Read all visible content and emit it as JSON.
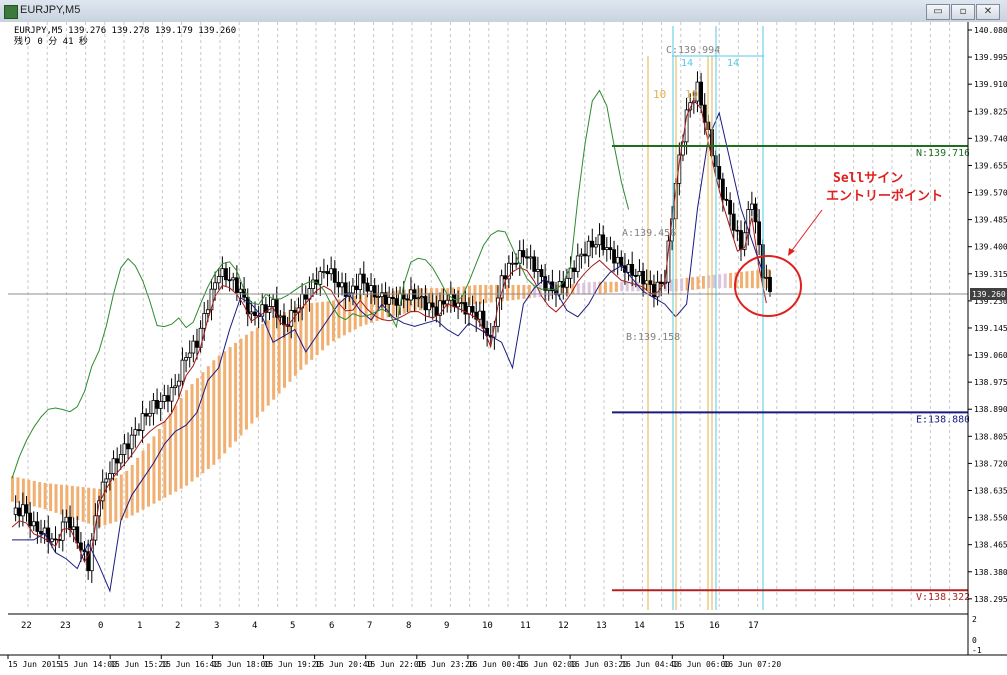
{
  "window": {
    "title": "EURJPY,M5",
    "minimize": "▭",
    "maximize": "▫",
    "close": "✕"
  },
  "chart_info": {
    "symbol_line": "EURJPY,M5  139.276 139.278 139.179 139.260",
    "countdown": "残り 0 分 41 秒"
  },
  "annotation": {
    "line1": "Sellサイン",
    "line2": "エントリーポイント"
  },
  "colors": {
    "cloud": "#f0a762",
    "cloud_lower": "#d8bfd8",
    "tenkan": "#a31a1a",
    "kijun": "#1a1a80",
    "chikou": "#2e8b2e",
    "n_level": "#1f6e1f",
    "e_level": "#1a1a80",
    "v_level": "#b22222",
    "annotation": "#e02020",
    "fib_orange": "#e8b04a",
    "fib_cyan": "#52c8e6"
  },
  "chart_data": {
    "type": "candlestick",
    "ylim": [
      138.26,
      140.08
    ],
    "yticks": [
      "140.080",
      "139.995",
      "139.910",
      "139.825",
      "139.740",
      "139.655",
      "139.570",
      "139.485",
      "139.400",
      "139.315",
      "139.230",
      "139.145",
      "139.060",
      "138.975",
      "138.890",
      "138.805",
      "138.720",
      "138.635",
      "138.550",
      "138.465",
      "138.380",
      "138.295"
    ],
    "current_price": "139.260",
    "hour_labels": [
      "22",
      "23",
      "0",
      "1",
      "2",
      "3",
      "4",
      "5",
      "6",
      "7",
      "8",
      "9",
      "10",
      "11",
      "12",
      "13",
      "14",
      "15",
      "16",
      "17"
    ],
    "date_labels": [
      "15 Jun 2015",
      "15 Jun 14:00",
      "15 Jun 15:20",
      "15 Jun 16:40",
      "15 Jun 18:00",
      "15 Jun 19:20",
      "15 Jun 20:40",
      "15 Jun 22:00",
      "15 Jun 23:20",
      "16 Jun 00:40",
      "16 Jun 02:00",
      "16 Jun 03:20",
      "16 Jun 04:40",
      "16 Jun 06:00",
      "16 Jun 07:20"
    ],
    "sub_axis": [
      "2",
      "0",
      "-1"
    ],
    "close_path": [
      [
        0,
        138.56
      ],
      [
        3,
        138.58
      ],
      [
        6,
        138.52
      ],
      [
        9,
        138.5
      ],
      [
        12,
        138.47
      ],
      [
        15,
        138.55
      ],
      [
        18,
        138.48
      ],
      [
        21,
        138.4
      ],
      [
        24,
        138.62
      ],
      [
        27,
        138.7
      ],
      [
        30,
        138.75
      ],
      [
        33,
        138.8
      ],
      [
        36,
        138.86
      ],
      [
        39,
        138.9
      ],
      [
        42,
        138.92
      ],
      [
        45,
        138.96
      ],
      [
        48,
        139.06
      ],
      [
        51,
        139.1
      ],
      [
        54,
        139.22
      ],
      [
        57,
        139.32
      ],
      [
        60,
        139.3
      ],
      [
        63,
        139.26
      ],
      [
        66,
        139.18
      ],
      [
        69,
        139.2
      ],
      [
        72,
        139.22
      ],
      [
        75,
        139.15
      ],
      [
        78,
        139.2
      ],
      [
        81,
        139.25
      ],
      [
        84,
        139.3
      ],
      [
        87,
        139.33
      ],
      [
        90,
        139.28
      ],
      [
        93,
        139.25
      ],
      [
        96,
        139.3
      ],
      [
        99,
        139.26
      ],
      [
        102,
        139.24
      ],
      [
        105,
        139.23
      ],
      [
        108,
        139.24
      ],
      [
        111,
        139.25
      ],
      [
        114,
        139.22
      ],
      [
        117,
        139.2
      ],
      [
        120,
        139.24
      ],
      [
        123,
        139.22
      ],
      [
        126,
        139.2
      ],
      [
        129,
        139.18
      ],
      [
        132,
        139.1
      ],
      [
        135,
        139.3
      ],
      [
        138,
        139.35
      ],
      [
        141,
        139.38
      ],
      [
        144,
        139.34
      ],
      [
        147,
        139.28
      ],
      [
        150,
        139.26
      ],
      [
        153,
        139.3
      ],
      [
        156,
        139.36
      ],
      [
        159,
        139.4
      ],
      [
        162,
        139.42
      ],
      [
        165,
        139.38
      ],
      [
        168,
        139.34
      ],
      [
        171,
        139.32
      ],
      [
        174,
        139.3
      ],
      [
        177,
        139.26
      ],
      [
        180,
        139.3
      ],
      [
        183,
        139.6
      ],
      [
        186,
        139.82
      ],
      [
        189,
        139.9
      ],
      [
        192,
        139.75
      ],
      [
        195,
        139.6
      ],
      [
        198,
        139.5
      ],
      [
        201,
        139.4
      ],
      [
        204,
        139.55
      ],
      [
        207,
        139.32
      ],
      [
        209,
        139.26
      ]
    ],
    "candle_range": [
      0,
      209
    ],
    "cloud": {
      "x": [
        0,
        8,
        16,
        24,
        32,
        40,
        48,
        56,
        64,
        72,
        80,
        88,
        96,
        104,
        112,
        120,
        128,
        136,
        144,
        152,
        160,
        168,
        176,
        184,
        192,
        200,
        209
      ],
      "upper": [
        138.68,
        138.66,
        138.65,
        138.64,
        138.7,
        138.82,
        138.95,
        139.05,
        139.12,
        139.18,
        139.22,
        139.23,
        139.25,
        139.26,
        139.27,
        139.27,
        139.28,
        139.28,
        139.28,
        139.28,
        139.29,
        139.29,
        139.29,
        139.3,
        139.31,
        139.32,
        139.33
      ],
      "lower": [
        138.6,
        138.58,
        138.55,
        138.52,
        138.55,
        138.6,
        138.65,
        138.72,
        138.82,
        138.92,
        139.02,
        139.1,
        139.15,
        139.18,
        139.2,
        139.21,
        139.22,
        139.23,
        139.24,
        139.25,
        139.25,
        139.26,
        139.26,
        139.26,
        139.27,
        139.27,
        139.27
      ]
    },
    "levels": [
      {
        "name": "N",
        "label": "N:139.716",
        "value": 139.716
      },
      {
        "name": "E",
        "label": "E:138.880",
        "value": 138.88
      },
      {
        "name": "V",
        "label": "V:138.322",
        "value": 138.322
      }
    ],
    "fib_labels": {
      "c": "C:139.994",
      "a": "A:139.456",
      "b": "B:139.158",
      "cyan_count": [
        "14",
        "14"
      ],
      "orange_count": [
        "10",
        "10"
      ]
    }
  }
}
